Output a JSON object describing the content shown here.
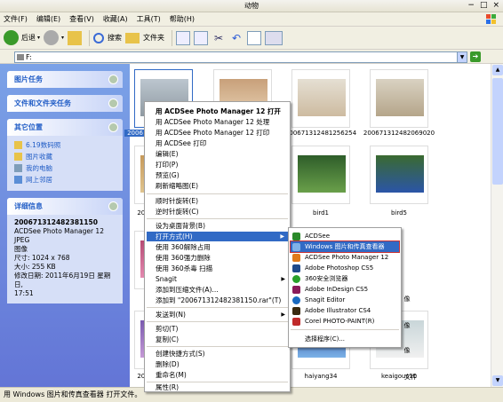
{
  "window": {
    "title": "动物"
  },
  "menubar": [
    "文件(F)",
    "编辑(E)",
    "查看(V)",
    "收藏(A)",
    "工具(T)",
    "帮助(H)"
  ],
  "toolbar": {
    "back": "后退",
    "search": "搜索",
    "folders": "文件夹"
  },
  "address": {
    "value": "F:"
  },
  "leftpane": {
    "picture_tasks": "图片任务",
    "file_folder_tasks": "文件和文件夹任务",
    "other_places": {
      "title": "其它位置",
      "items": [
        "6.19数码照",
        "图片收藏",
        "我的电脑",
        "网上邻居"
      ]
    },
    "details": {
      "title": "详细信息",
      "filename": "200671312482381150",
      "type_line1": "ACDSee Photo Manager 12 JPEG",
      "type_line2": "图像",
      "dimensions": "尺寸: 1024 x 768",
      "size": "大小: 255 KB",
      "modified_line1": "修改日期: 2011年6月19日 星期日,",
      "modified_line2": "17:51"
    }
  },
  "thumbs": {
    "captions": [
      "2006",
      "200671312481256254",
      "200671312482069020",
      "200",
      "bird1",
      "bird5",
      "haiyang34",
      "keaigous10",
      "200"
    ],
    "right_edge": [
      "像",
      "像",
      "像",
      "文件"
    ]
  },
  "context_menu": {
    "items": [
      "用 ACDSee Photo Manager 12 打开",
      "用 ACDSee Photo Manager 12 处理",
      "用 ACDSee Photo Manager 12 打印",
      "用 ACDSee 打印",
      "编辑(E)",
      "打印(P)",
      "预览(G)",
      "刷新缩略图(E)",
      "顺时针旋转(E)",
      "逆时针旋转(C)",
      "设为桌面背景(B)",
      "打开方式(H)",
      "使用 360解除占用",
      "使用 360强力删除",
      "使用 360杀毒 扫描",
      "Snagit",
      "添加到压缩文件(A)...",
      "添加到 \"200671312482381150.rar\"(T)",
      "发送到(N)",
      "剪切(T)",
      "复制(C)",
      "创建快捷方式(S)",
      "删除(D)",
      "重命名(M)",
      "属性(R)"
    ]
  },
  "submenu": {
    "items": [
      "ACDSee",
      "Windows 图片和传真查看器",
      "ACDSee Photo Manager 12",
      "Adobe Photoshop CS5",
      "360安全浏览器",
      "Adobe InDesign CS5",
      "Snagit Editor",
      "Adobe Illustrator CS4",
      "Corel PHOTO-PAINT(R)",
      "选择程序(C)..."
    ]
  },
  "status": "用 Windows 图片和传真查看器 打开文件。"
}
